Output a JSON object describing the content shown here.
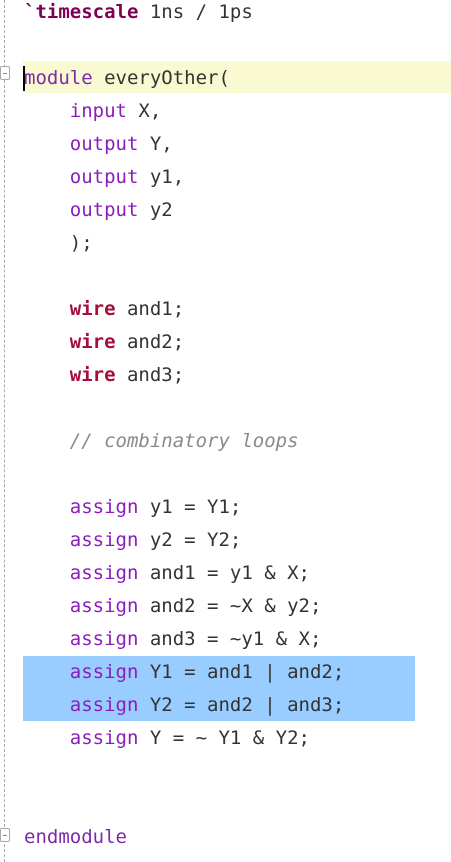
{
  "editor": {
    "lines": [
      {
        "tokens": [
          {
            "t": "`timescale",
            "c": "kw-bold"
          },
          {
            "t": " 1ns / 1ps",
            "c": ""
          }
        ]
      },
      {
        "tokens": []
      },
      {
        "tokens": [
          {
            "t": "module",
            "c": "kw-module"
          },
          {
            "t": " everyOther(",
            "c": ""
          }
        ]
      },
      {
        "tokens": [
          {
            "t": "    ",
            "c": ""
          },
          {
            "t": "input",
            "c": "kw-purple"
          },
          {
            "t": " X,",
            "c": ""
          }
        ]
      },
      {
        "tokens": [
          {
            "t": "    ",
            "c": ""
          },
          {
            "t": "output",
            "c": "kw-purple"
          },
          {
            "t": " Y,",
            "c": ""
          }
        ]
      },
      {
        "tokens": [
          {
            "t": "    ",
            "c": ""
          },
          {
            "t": "output",
            "c": "kw-purple"
          },
          {
            "t": " y1,",
            "c": ""
          }
        ]
      },
      {
        "tokens": [
          {
            "t": "    ",
            "c": ""
          },
          {
            "t": "output",
            "c": "kw-purple"
          },
          {
            "t": " y2",
            "c": ""
          }
        ]
      },
      {
        "tokens": [
          {
            "t": "    );",
            "c": ""
          }
        ]
      },
      {
        "tokens": []
      },
      {
        "tokens": [
          {
            "t": "    ",
            "c": ""
          },
          {
            "t": "wire",
            "c": "kw-wire"
          },
          {
            "t": " and1;",
            "c": ""
          }
        ]
      },
      {
        "tokens": [
          {
            "t": "    ",
            "c": ""
          },
          {
            "t": "wire",
            "c": "kw-wire"
          },
          {
            "t": " and2;",
            "c": ""
          }
        ]
      },
      {
        "tokens": [
          {
            "t": "    ",
            "c": ""
          },
          {
            "t": "wire",
            "c": "kw-wire"
          },
          {
            "t": " and3;",
            "c": ""
          }
        ]
      },
      {
        "tokens": []
      },
      {
        "tokens": [
          {
            "t": "    ",
            "c": ""
          },
          {
            "t": "// combinatory loops",
            "c": "comment"
          }
        ]
      },
      {
        "tokens": []
      },
      {
        "tokens": [
          {
            "t": "    ",
            "c": ""
          },
          {
            "t": "assign",
            "c": "kw-purple"
          },
          {
            "t": " y1 = Y1;",
            "c": ""
          }
        ]
      },
      {
        "tokens": [
          {
            "t": "    ",
            "c": ""
          },
          {
            "t": "assign",
            "c": "kw-purple"
          },
          {
            "t": " y2 = Y2;",
            "c": ""
          }
        ]
      },
      {
        "tokens": [
          {
            "t": "    ",
            "c": ""
          },
          {
            "t": "assign",
            "c": "kw-purple"
          },
          {
            "t": " and1 = y1 & X;",
            "c": ""
          }
        ]
      },
      {
        "tokens": [
          {
            "t": "    ",
            "c": ""
          },
          {
            "t": "assign",
            "c": "kw-purple"
          },
          {
            "t": " and2 = ~X & y2;",
            "c": ""
          }
        ]
      },
      {
        "tokens": [
          {
            "t": "    ",
            "c": ""
          },
          {
            "t": "assign",
            "c": "kw-purple"
          },
          {
            "t": " and3 = ~y1 & X;",
            "c": ""
          }
        ]
      },
      {
        "tokens": [
          {
            "t": "    ",
            "c": ""
          },
          {
            "t": "assign",
            "c": "kw-purple"
          },
          {
            "t": " Y1 = and1 | and2;",
            "c": ""
          }
        ]
      },
      {
        "tokens": [
          {
            "t": "    ",
            "c": ""
          },
          {
            "t": "assign",
            "c": "kw-purple"
          },
          {
            "t": " Y2 = and2 | and3;",
            "c": ""
          }
        ]
      },
      {
        "tokens": [
          {
            "t": "    ",
            "c": ""
          },
          {
            "t": "assign",
            "c": "kw-purple"
          },
          {
            "t": " Y = ~ Y1 & Y2;",
            "c": ""
          }
        ]
      },
      {
        "tokens": []
      },
      {
        "tokens": []
      },
      {
        "tokens": [
          {
            "t": "endmodule",
            "c": "kw-module"
          }
        ]
      }
    ],
    "selected_line_numbers": [
      21,
      22
    ],
    "current_line_number": 3,
    "colors": {
      "background": "#ffffff",
      "current_line": "#fafad2",
      "selection": "#99ccff",
      "keyword_purple": "#8b1dba",
      "keyword_bold": "#7f0055",
      "keyword_wire": "#a50e3a",
      "comment": "#8a8a8a"
    },
    "gutter_icons": [
      "fold-collapse-icon",
      "fold-collapse-icon"
    ]
  }
}
